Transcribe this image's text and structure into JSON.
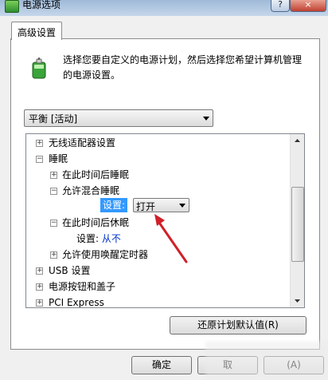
{
  "window": {
    "title": "电源选项",
    "help_glyph": "?",
    "close_glyph": "×"
  },
  "tab": {
    "label": "高级设置"
  },
  "description": "选择您要自定义的电源计划，然后选择您希望计算机管理的电源设置。",
  "plan_select": {
    "value": "平衡 [活动]"
  },
  "tree": [
    {
      "exp": "+",
      "label": "无线适配器设置",
      "level": 0
    },
    {
      "exp": "−",
      "label": "睡眠",
      "level": 0
    },
    {
      "exp": "+",
      "label": "在此时间后睡眠",
      "level": 1
    },
    {
      "exp": "−",
      "label": "允许混合睡眠",
      "level": 1
    },
    {
      "exp": "",
      "label": "",
      "level": 2
    },
    {
      "exp": "−",
      "label": "在此时间后休眠",
      "level": 1
    },
    {
      "exp": "",
      "label": "设置: ",
      "value": "从不",
      "level": 2
    },
    {
      "exp": "+",
      "label": "允许使用唤醒定时器",
      "level": 1
    },
    {
      "exp": "+",
      "label": "USB 设置",
      "level": 0
    },
    {
      "exp": "+",
      "label": "电源按钮和盖子",
      "level": 0
    },
    {
      "exp": "+",
      "label": "PCI Express",
      "level": 0
    }
  ],
  "hybrid_setting": {
    "label": "设置:",
    "value": "打开"
  },
  "buttons": {
    "restore": "还原计划默认值(R)",
    "ok": "确定",
    "cancel": "取",
    "apply": "(A)"
  },
  "colors": {
    "selection": "#3399ff",
    "link_value": "#0033cc",
    "arrow": "#d0202a"
  }
}
